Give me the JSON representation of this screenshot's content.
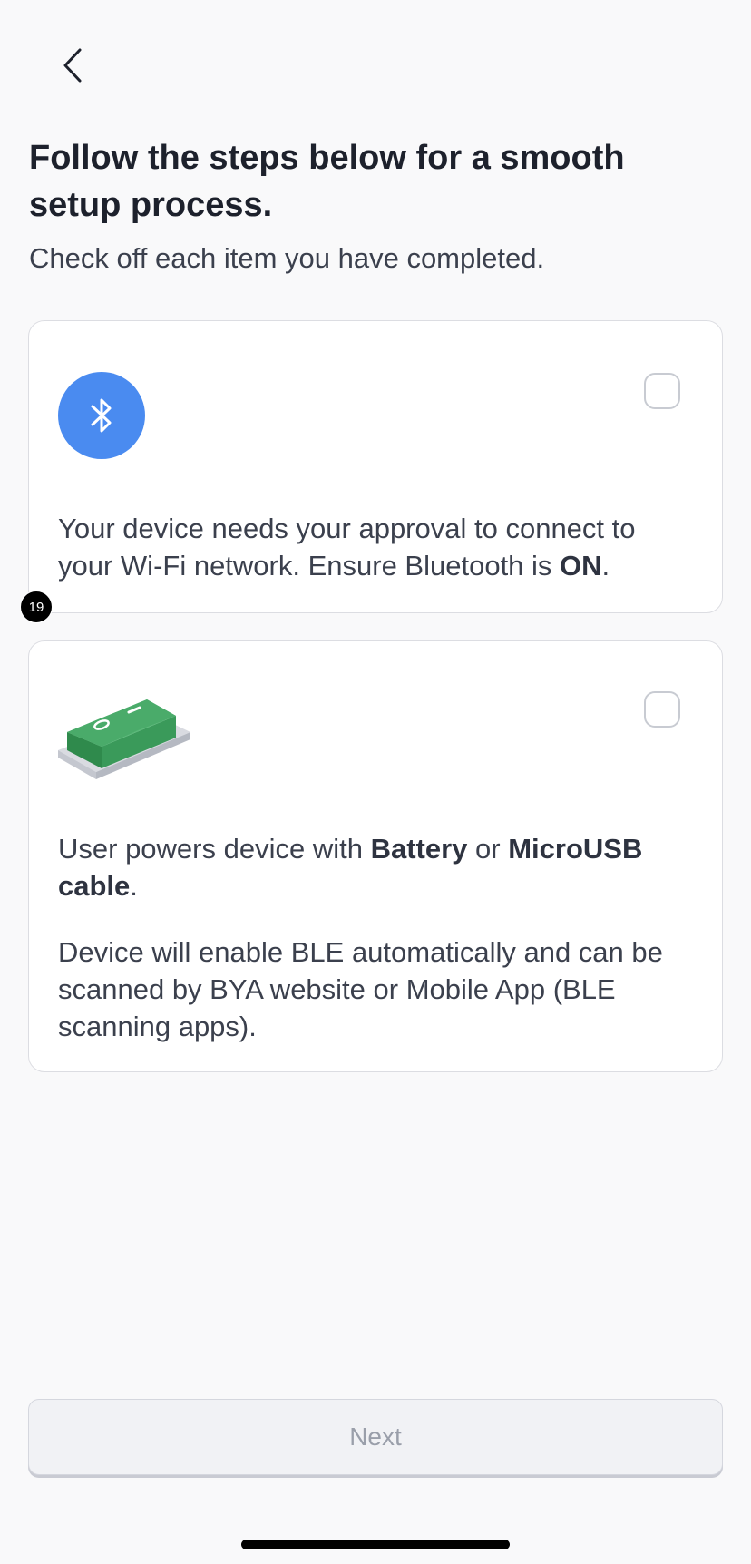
{
  "header": {
    "back_icon": "chevron-left-icon",
    "title": "Follow the steps below for a smooth setup process.",
    "subtitle": "Check off each item you have completed."
  },
  "steps": [
    {
      "icon": "bluetooth-icon",
      "icon_color": "#4a8bf0",
      "checked": false,
      "text_before": "Your device needs your approval to connect to your Wi-Fi network. Ensure Bluetooth is ",
      "text_bold": "ON",
      "text_after": "."
    },
    {
      "icon": "power-switch-icon",
      "icon_color": "#3a9a5a",
      "checked": false,
      "p1_before": "User powers device with ",
      "p1_bold1": "Battery",
      "p1_mid": " or ",
      "p1_bold2": "MicroUSB cable",
      "p1_after": ".",
      "p2": "Device will enable BLE automatically and can be scanned by BYA website or Mobile App (BLE scanning apps)."
    }
  ],
  "overlay_badge": "19",
  "footer": {
    "next_label": "Next",
    "next_enabled": false
  }
}
